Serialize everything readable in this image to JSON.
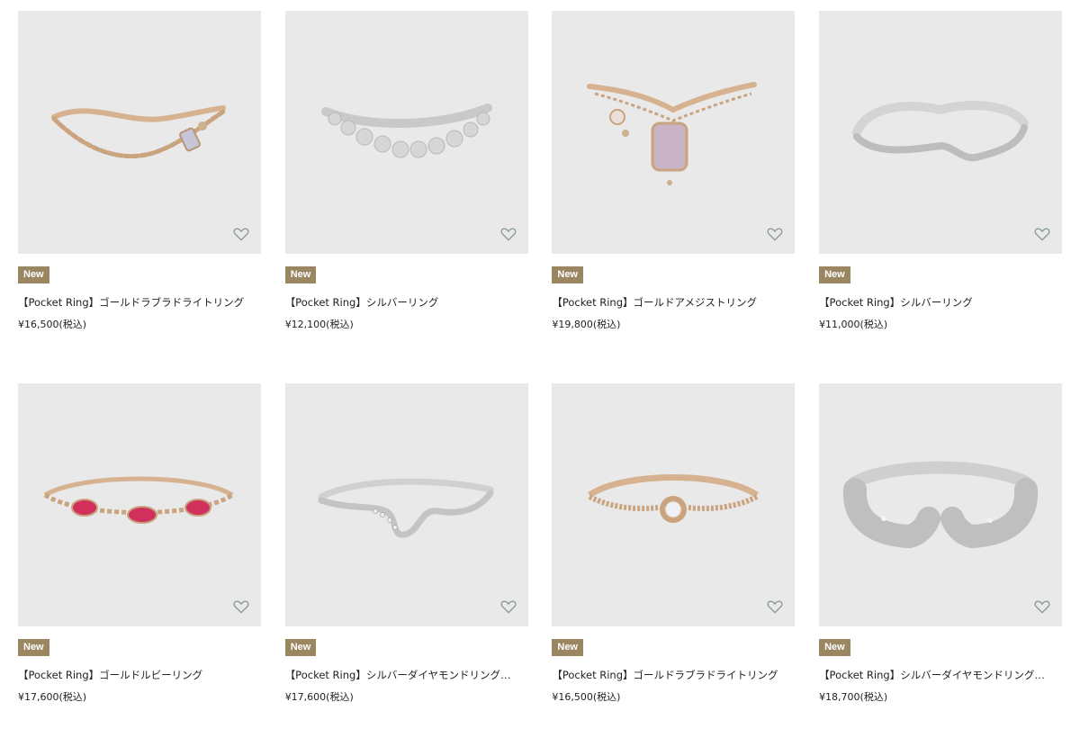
{
  "products": [
    {
      "badge": "New",
      "name": "【Pocket Ring】ゴールドラブラドライトリング",
      "price": "¥16,500(税込)"
    },
    {
      "badge": "New",
      "name": "【Pocket Ring】シルバーリング",
      "price": "¥12,100(税込)"
    },
    {
      "badge": "New",
      "name": "【Pocket Ring】ゴールドアメジストリング",
      "price": "¥19,800(税込)"
    },
    {
      "badge": "New",
      "name": "【Pocket Ring】シルバーリング",
      "price": "¥11,000(税込)"
    },
    {
      "badge": "New",
      "name": "【Pocket Ring】ゴールドルビーリング",
      "price": "¥17,600(税込)"
    },
    {
      "badge": "New",
      "name": "【Pocket Ring】シルバーダイヤモンドリング…",
      "price": "¥17,600(税込)"
    },
    {
      "badge": "New",
      "name": "【Pocket Ring】ゴールドラブラドライトリング",
      "price": "¥16,500(税込)"
    },
    {
      "badge": "New",
      "name": "【Pocket Ring】シルバーダイヤモンドリング…",
      "price": "¥18,700(税込)"
    }
  ],
  "colors": {
    "badge": "#9a8762",
    "thumb_bg": "#e9e9e9",
    "favorite_icon": "#8a9a92"
  },
  "icons": {
    "favorite": "heart-outline-icon"
  }
}
